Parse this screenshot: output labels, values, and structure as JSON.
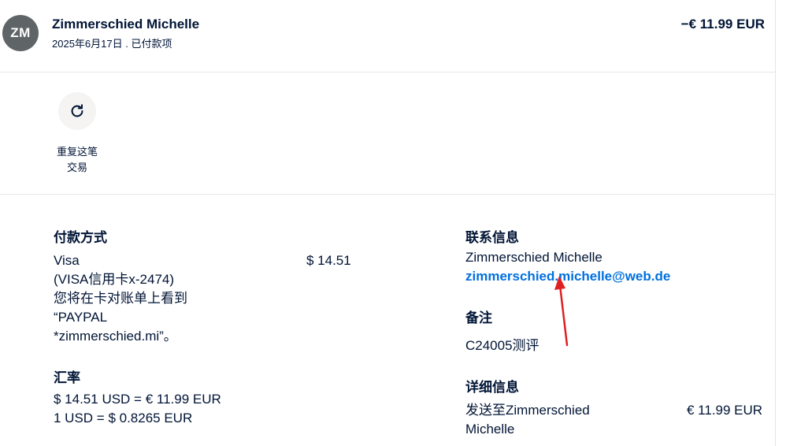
{
  "header": {
    "avatar_initials": "ZM",
    "name": "Zimmerschied Michelle",
    "subtitle": "2025年6月17日 . 已付款项",
    "amount": "−€ 11.99 EUR"
  },
  "actions": {
    "repeat_label_line1": "重复这笔",
    "repeat_label_line2": "交易",
    "icon": "refresh-icon"
  },
  "payment": {
    "title": "付款方式",
    "lines": [
      "Visa",
      "(VISA信用卡x-2474)",
      "您将在卡对账单上看到",
      "“PAYPAL",
      "*zimmerschied.mi”。"
    ],
    "amount": "$ 14.51"
  },
  "exchange": {
    "title": "汇率",
    "line1": "$ 14.51 USD = € 11.99 EUR",
    "line2": "1 USD = $ 0.8265 EUR"
  },
  "contact": {
    "title": "联系信息",
    "name": "Zimmerschied Michelle",
    "email": "zimmerschied.michelle@web.de"
  },
  "notes": {
    "title": "备注",
    "text": "C24005测评"
  },
  "details": {
    "title": "详细信息",
    "line1": "发送至Zimmerschied",
    "line2": "Michelle",
    "amount": "€ 11.99 EUR"
  },
  "colors": {
    "text": "#001435",
    "link": "#0070e0",
    "avatar": "#5f6466",
    "annotation_arrow": "#e02020"
  }
}
